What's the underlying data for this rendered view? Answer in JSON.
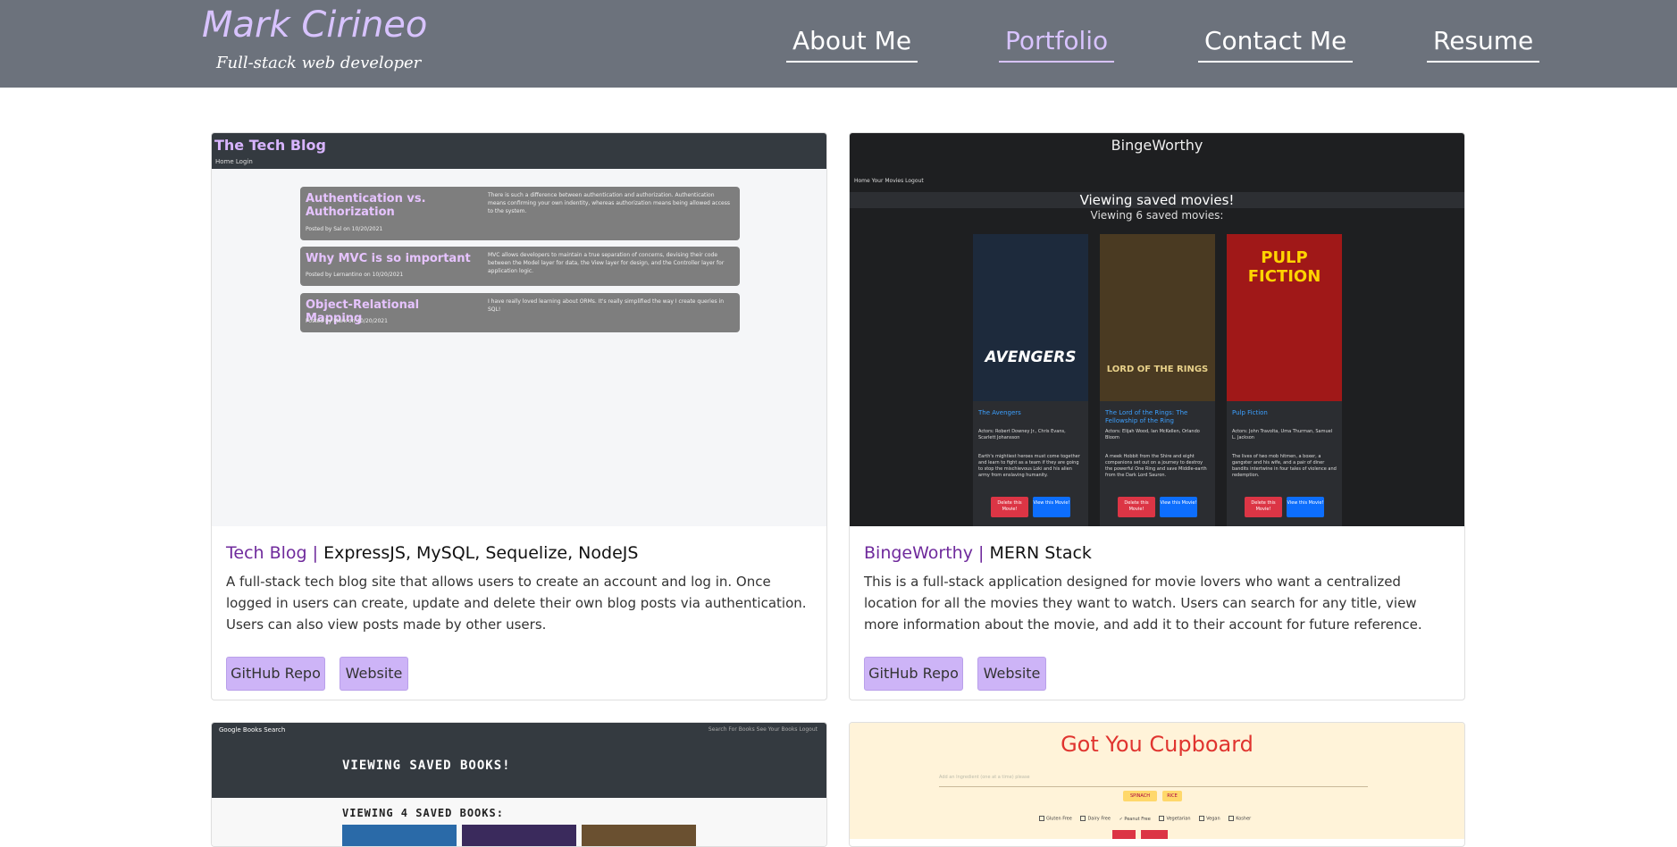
{
  "header": {
    "name": "Mark Cirineo",
    "tagline": "Full-stack web developer",
    "nav": [
      {
        "label": "About Me"
      },
      {
        "label": "Portfolio"
      },
      {
        "label": "Contact Me"
      },
      {
        "label": "Resume"
      }
    ]
  },
  "projects": [
    {
      "name": "Tech Blog",
      "separator": "|",
      "tech": "ExpressJS, MySQL, Sequelize, NodeJS",
      "description": "A full-stack tech blog site that allows users to create an account and log in. Once logged in users can create, update and delete their own blog posts via authentication. Users can also view posts made by other users.",
      "repo_label": "GitHub Repo",
      "site_label": "Website",
      "preview": {
        "brand": "The Tech Blog",
        "nav": "Home  Login",
        "posts": [
          {
            "title": "Authentication vs. Authorization",
            "meta": "Posted by Sal on 10/20/2021",
            "body": "There is such a difference between authentication and authorization. Authentication means confirming your own indentity, whereas authorization means being allowed access to the system."
          },
          {
            "title": "Why MVC is so important",
            "meta": "Posted by Lernantino on 10/20/2021",
            "body": "MVC allows developers to maintain a true separation of concerns, devising their code between the Model layer for data, the View layer for design, and the Controller layer for application logic."
          },
          {
            "title": "Object-Relational Mapping",
            "meta": "Posted by Mark on 10/20/2021",
            "body": "I have really loved learning about ORMs. It's really simplified the way I create queries in SQL!"
          }
        ]
      }
    },
    {
      "name": "BingeWorthy",
      "separator": "|",
      "tech": "MERN Stack",
      "description": "This is a full-stack application designed for movie lovers who want a centralized location for all the movies they want to watch. Users can search for any title, view more information about the movie, and add it to their account for future reference.",
      "repo_label": "GitHub Repo",
      "site_label": "Website",
      "preview": {
        "brand": "BingeWorthy",
        "nav": "Home   Your Movies   Logout",
        "heading": "Viewing saved movies!",
        "subheading": "Viewing 6 saved movies:",
        "movies": [
          {
            "poster_text": "AVENGERS",
            "poster_color": "#1d2a3c",
            "accent": "#ffffff",
            "title": "The Avengers",
            "actors": "Actors: Robert Downey Jr., Chris Evans, Scarlett Johansson",
            "plot": "Earth's mightiest heroes must come together and learn to fight as a team if they are going to stop the mischievous Loki and his alien army from enslaving humanity.",
            "delete_label": "Delete this Movie!",
            "view_label": "View this Movie!"
          },
          {
            "poster_text": "LORD OF THE RINGS",
            "poster_color": "#4a3a22",
            "accent": "#e8d18a",
            "title": "The Lord of the Rings: The Fellowship of the Ring",
            "actors": "Actors: Elijah Wood, Ian McKellen, Orlando Bloom",
            "plot": "A meek Hobbit from the Shire and eight companions set out on a journey to destroy the powerful One Ring and save Middle-earth from the Dark Lord Sauron.",
            "delete_label": "Delete this Movie!",
            "view_label": "View this Movie!"
          },
          {
            "poster_text": "PULP FICTION",
            "poster_color": "#a01818",
            "accent": "#ffd400",
            "title": "Pulp Fiction",
            "actors": "Actors: John Travolta, Uma Thurman, Samuel L. Jackson",
            "plot": "The lives of two mob hitmen, a boxer, a gangster and his wife, and a pair of diner bandits intertwine in four tales of violence and redemption.",
            "delete_label": "Delete this Movie!",
            "view_label": "View this Movie!"
          }
        ]
      }
    },
    {
      "preview": {
        "brand": "Google Books Search",
        "nav": "Search For Books   See Your Books   Logout",
        "heading": "VIEWING SAVED BOOKS!",
        "subheading": "VIEWING 4 SAVED BOOKS:"
      }
    },
    {
      "preview": {
        "title": "Got You Cupboard",
        "input_placeholder": "Add an Ingredient (one at a time) please",
        "chips": [
          "SPINACH",
          "RICE"
        ],
        "checks": [
          "Gluten Free",
          "Dairy Free",
          "Peanut Free",
          "Vegetarian",
          "Vegan",
          "Kosher"
        ]
      }
    }
  ],
  "colors": {
    "header_bg": "#6c727c",
    "brand_accent": "#d8c3ff",
    "button_bg": "#cdb4f7",
    "project_name": "#6f2a9c"
  }
}
